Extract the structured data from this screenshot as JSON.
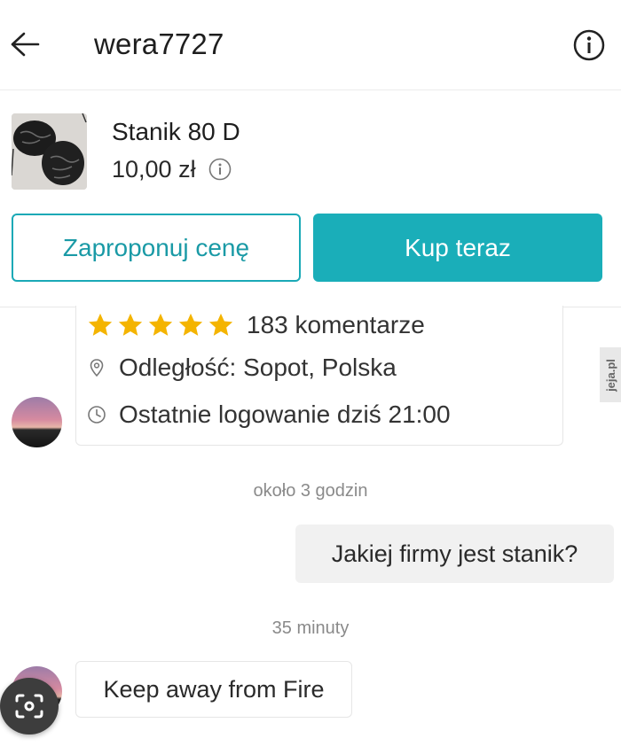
{
  "header": {
    "username": "wera7727",
    "back_icon": "arrow-left-icon",
    "info_icon": "info-circle-icon"
  },
  "product": {
    "title": "Stanik 80 D",
    "price": "10,00 zł",
    "offer_button": "Zaproponuj cenę",
    "buy_button": "Kup teraz",
    "accent_color": "#1aaeb9"
  },
  "profile": {
    "rating_stars": 5,
    "review_count": "183 komentarze",
    "location": "Odległość: Sopot, Polska",
    "last_login": "Ostatnie logowanie dziś 21:00",
    "star_color": "#f4b400"
  },
  "messages": [
    {
      "timestamp": "około  3 godzin",
      "text": "Jakiej firmy jest stanik?",
      "from": "me"
    },
    {
      "timestamp": "35 minuty",
      "text": "Keep away from Fire",
      "from": "seller"
    }
  ],
  "watermark": "jeja.pl"
}
